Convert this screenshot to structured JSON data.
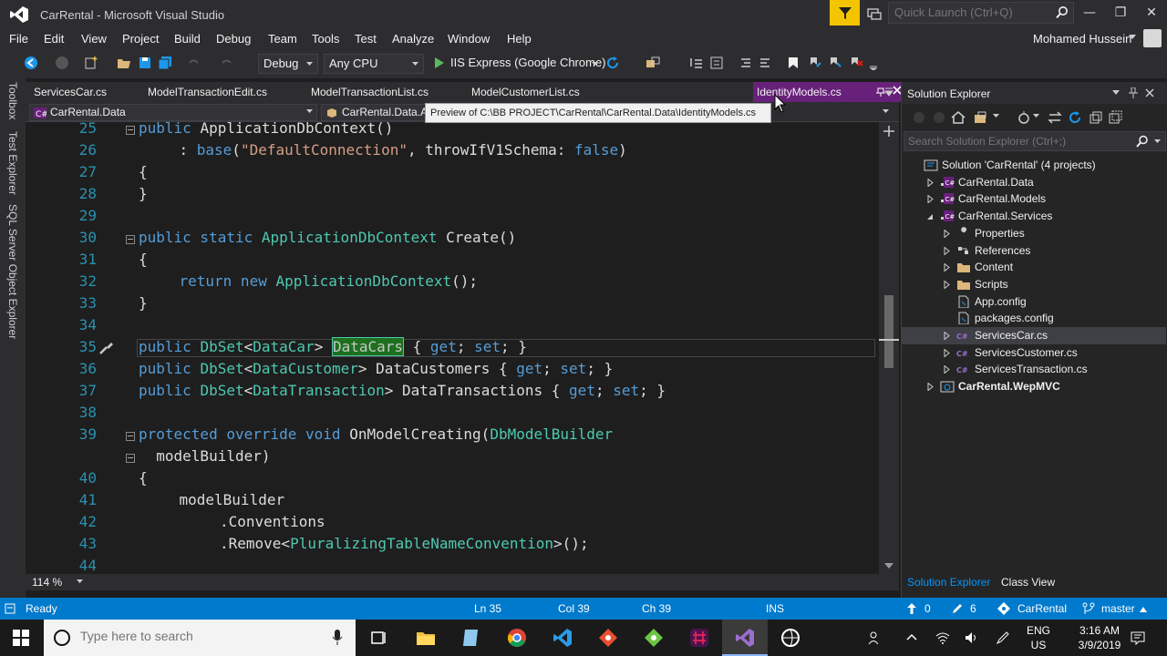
{
  "window": {
    "title": "CarRental - Microsoft Visual Studio",
    "quick_launch_placeholder": "Quick Launch (Ctrl+Q)",
    "user": "Mohamed Hussein"
  },
  "menu": [
    "File",
    "Edit",
    "View",
    "Project",
    "Build",
    "Debug",
    "Team",
    "Tools",
    "Test",
    "Analyze",
    "Window",
    "Help"
  ],
  "toolbar": {
    "configuration": "Debug",
    "platform": "Any CPU",
    "run_target": "IIS Express (Google Chrome)"
  },
  "left_tool_tabs": [
    "Toolbox",
    "Test Explorer",
    "SQL Server Object Explorer"
  ],
  "doc_tabs": [
    {
      "label": "ServicesCar.cs"
    },
    {
      "label": "ModelTransactionEdit.cs"
    },
    {
      "label": "ModelTransactionList.cs"
    },
    {
      "label": "ModelCustomerList.cs"
    },
    {
      "label": "IdentityModels.cs",
      "active": true
    }
  ],
  "tooltip": "Preview of C:\\BB PROJECT\\CarRental\\CarRental.Data\\IdentityModels.cs",
  "nav": {
    "project": "CarRental.Data",
    "type": "CarRental.Data.Ap"
  },
  "code_lines": [
    {
      "num": "25",
      "indent": 2,
      "tokens": [
        [
          "kw",
          "public "
        ],
        [
          "",
          "ApplicationDbContext()"
        ]
      ]
    },
    {
      "num": "26",
      "indent": 3,
      "tokens": [
        [
          "",
          ": "
        ],
        [
          "kw",
          "base"
        ],
        [
          "",
          "("
        ],
        [
          "str",
          "\"DefaultConnection\""
        ],
        [
          "",
          ", throwIfV1Schema: "
        ],
        [
          "kw",
          "false"
        ],
        [
          "",
          ")"
        ]
      ]
    },
    {
      "num": "27",
      "indent": 2,
      "tokens": [
        [
          "",
          "{"
        ]
      ]
    },
    {
      "num": "28",
      "indent": 2,
      "tokens": [
        [
          "",
          "}"
        ]
      ]
    },
    {
      "num": "29",
      "indent": 0,
      "tokens": []
    },
    {
      "num": "30",
      "indent": 2,
      "tokens": [
        [
          "kw",
          "public static "
        ],
        [
          "ty",
          "ApplicationDbContext"
        ],
        [
          "",
          " Create()"
        ]
      ]
    },
    {
      "num": "31",
      "indent": 2,
      "tokens": [
        [
          "",
          "{"
        ]
      ]
    },
    {
      "num": "32",
      "indent": 3,
      "tokens": [
        [
          "kw",
          "return new "
        ],
        [
          "ty",
          "ApplicationDbContext"
        ],
        [
          "",
          "();"
        ]
      ]
    },
    {
      "num": "33",
      "indent": 2,
      "tokens": [
        [
          "",
          "}"
        ]
      ]
    },
    {
      "num": "34",
      "indent": 0,
      "tokens": []
    },
    {
      "num": "35",
      "indent": 2,
      "tokens": [
        [
          "kw",
          "public "
        ],
        [
          "ty",
          "DbSet"
        ],
        [
          "",
          "<"
        ],
        [
          "ty",
          "DataCar"
        ],
        [
          "",
          "> "
        ],
        [
          "hl",
          "DataCars"
        ],
        [
          "",
          " { "
        ],
        [
          "kw",
          "get"
        ],
        [
          "",
          "; "
        ],
        [
          "kw",
          "set"
        ],
        [
          "",
          "; }"
        ]
      ]
    },
    {
      "num": "36",
      "indent": 2,
      "tokens": [
        [
          "kw",
          "public "
        ],
        [
          "ty",
          "DbSet"
        ],
        [
          "",
          "<"
        ],
        [
          "ty",
          "DataCustomer"
        ],
        [
          "",
          "> DataCustomers { "
        ],
        [
          "kw",
          "get"
        ],
        [
          "",
          "; "
        ],
        [
          "kw",
          "set"
        ],
        [
          "",
          "; }"
        ]
      ]
    },
    {
      "num": "37",
      "indent": 2,
      "tokens": [
        [
          "kw",
          "public "
        ],
        [
          "ty",
          "DbSet"
        ],
        [
          "",
          "<"
        ],
        [
          "ty",
          "DataTransaction"
        ],
        [
          "",
          "> DataTransactions { "
        ],
        [
          "kw",
          "get"
        ],
        [
          "",
          "; "
        ],
        [
          "kw",
          "set"
        ],
        [
          "",
          "; }"
        ]
      ]
    },
    {
      "num": "38",
      "indent": 0,
      "tokens": []
    },
    {
      "num": "39",
      "indent": 2,
      "tokens": [
        [
          "kw",
          "protected override void "
        ],
        [
          "",
          "OnModelCreating("
        ],
        [
          "ty",
          "DbModelBuilder"
        ]
      ]
    },
    {
      "num": "",
      "indent": 2,
      "tokens": [
        [
          "",
          "  modelBuilder)"
        ]
      ]
    },
    {
      "num": "40",
      "indent": 2,
      "tokens": [
        [
          "",
          "{"
        ]
      ]
    },
    {
      "num": "41",
      "indent": 3,
      "tokens": [
        [
          "",
          "modelBuilder"
        ]
      ]
    },
    {
      "num": "42",
      "indent": 4,
      "tokens": [
        [
          "",
          ".Conventions"
        ]
      ]
    },
    {
      "num": "43",
      "indent": 4,
      "tokens": [
        [
          "",
          ".Remove<"
        ],
        [
          "ty",
          "PluralizingTableNameConvention"
        ],
        [
          "",
          ">();"
        ]
      ]
    },
    {
      "num": "44",
      "indent": 0,
      "tokens": []
    }
  ],
  "zoom": "114 %",
  "solution_explorer": {
    "title": "Solution Explorer",
    "search_placeholder": "Search Solution Explorer (Ctrl+;)",
    "items": [
      {
        "label": "Solution 'CarRental' (4 projects)",
        "level": 0,
        "icon": "solution-icon",
        "expander": "none"
      },
      {
        "label": "CarRental.Data",
        "level": 1,
        "icon": "csharp-project-icon",
        "expander": "collapsed"
      },
      {
        "label": "CarRental.Models",
        "level": 1,
        "icon": "csharp-project-icon",
        "expander": "collapsed"
      },
      {
        "label": "CarRental.Services",
        "level": 1,
        "icon": "csharp-project-icon",
        "expander": "expanded"
      },
      {
        "label": "Properties",
        "level": 2,
        "icon": "wrench-icon",
        "expander": "collapsed"
      },
      {
        "label": "References",
        "level": 2,
        "icon": "references-icon",
        "expander": "collapsed"
      },
      {
        "label": "Content",
        "level": 2,
        "icon": "folder-icon",
        "expander": "collapsed"
      },
      {
        "label": "Scripts",
        "level": 2,
        "icon": "folder-icon",
        "expander": "collapsed"
      },
      {
        "label": "App.config",
        "level": 2,
        "icon": "config-file-icon",
        "expander": "none"
      },
      {
        "label": "packages.config",
        "level": 2,
        "icon": "config-file-icon",
        "expander": "none"
      },
      {
        "label": "ServicesCar.cs",
        "level": 2,
        "icon": "csharp-file-icon",
        "expander": "collapsed",
        "selected": true
      },
      {
        "label": "ServicesCustomer.cs",
        "level": 2,
        "icon": "csharp-file-icon",
        "expander": "collapsed"
      },
      {
        "label": "ServicesTransaction.cs",
        "level": 2,
        "icon": "csharp-file-icon",
        "expander": "collapsed"
      },
      {
        "label": "CarRental.WepMVC",
        "level": 1,
        "icon": "web-project-icon",
        "expander": "collapsed",
        "bold": true
      }
    ],
    "bottom_tabs": [
      "Solution Explorer",
      "Class View"
    ]
  },
  "status": {
    "ready": "Ready",
    "ln": "Ln 35",
    "col": "Col 39",
    "ch": "Ch 39",
    "mode": "INS",
    "up_count": "0",
    "edit_count": "6",
    "repo": "CarRental",
    "branch": "master"
  },
  "taskbar": {
    "search_placeholder": "Type here to search",
    "lang_top": "ENG",
    "lang_bottom": "US",
    "time": "3:16 AM",
    "date": "3/9/2019"
  },
  "colors": {
    "accent": "#007acc",
    "active_tab": "#68217a",
    "keyword": "#569cd6",
    "type": "#4ec9b0",
    "string": "#d69d85",
    "line_number": "#2b91af"
  }
}
